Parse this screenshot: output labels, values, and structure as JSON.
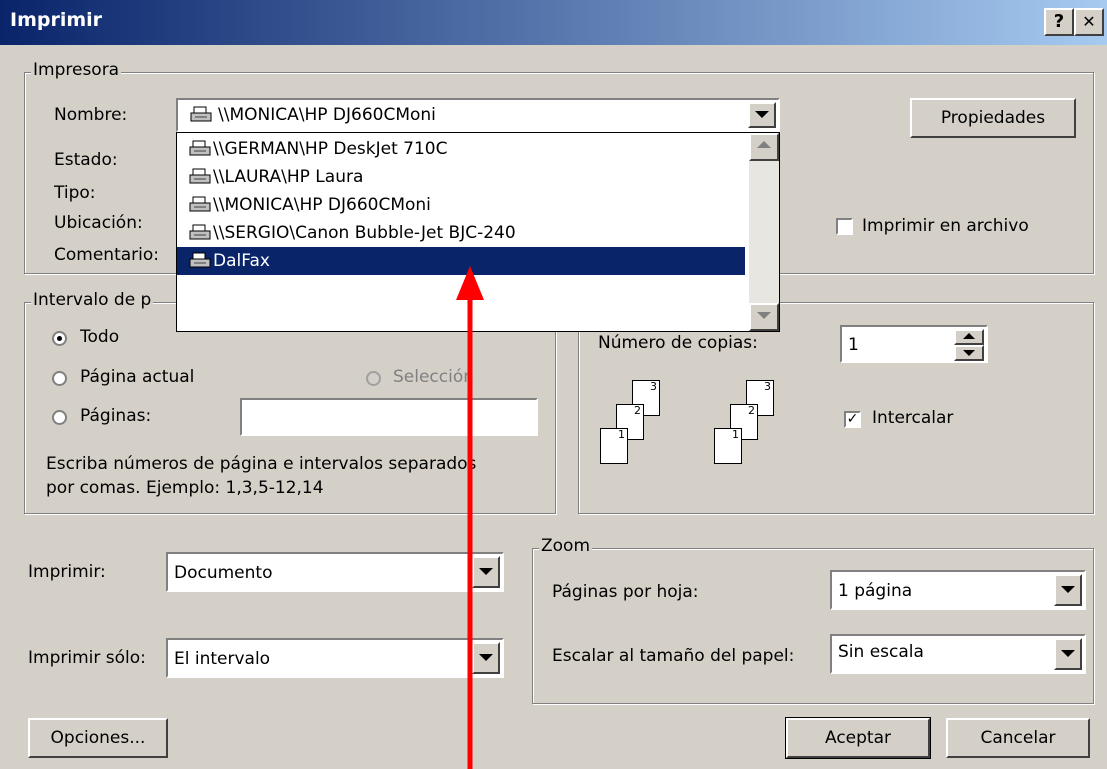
{
  "window": {
    "title": "Imprimir",
    "help_label": "?",
    "close_label": "✕"
  },
  "printer": {
    "group_label": "Impresora",
    "name_label": "Nombre:",
    "selected": "\\\\MONICA\\HP DJ660CMoni",
    "estado_label": "Estado:",
    "tipo_label": "Tipo:",
    "ubicacion_label": "Ubicación:",
    "comentario_label": "Comentario:",
    "properties_label": "Propiedades",
    "print_to_file_label": "Imprimir en archivo",
    "print_to_file_checked": false,
    "dropdown_items": [
      "\\\\GERMAN\\HP DeskJet 710C",
      "\\\\LAURA\\HP Laura",
      "\\\\MONICA\\HP DJ660CMoni",
      "\\\\SERGIO\\Canon Bubble-Jet BJC-240",
      "DalFax"
    ],
    "highlighted_index": 4
  },
  "range": {
    "group_label": "Intervalo de p",
    "all_label": "Todo",
    "current_label": "Página actual",
    "selection_label": "Selección",
    "pages_label": "Páginas:",
    "pages_value": "",
    "hint_line1": "Escriba números de página e intervalos separados",
    "hint_line2": "por comas. Ejemplo: 1,3,5-12,14",
    "selected": "all"
  },
  "copies": {
    "count_label": "Número de copias:",
    "count_value": "1",
    "collate_label": "Intercalar",
    "collate_checked": true
  },
  "print_what": {
    "label": "Imprimir:",
    "value": "Documento"
  },
  "print_only": {
    "label": "Imprimir sólo:",
    "value": "El intervalo"
  },
  "zoom": {
    "group_label": "Zoom",
    "pages_per_sheet_label": "Páginas por hoja:",
    "pages_per_sheet_value": "1 página",
    "scale_label": "Escalar al tamaño del papel:",
    "scale_value": "Sin escala"
  },
  "buttons": {
    "options": "Opciones...",
    "ok": "Aceptar",
    "cancel": "Cancelar"
  },
  "colors": {
    "title_bar": "#0a246a",
    "selection": "#0a246a",
    "annotation_arrow": "#ff0000",
    "dialog_bg": "#d4d0c8"
  }
}
